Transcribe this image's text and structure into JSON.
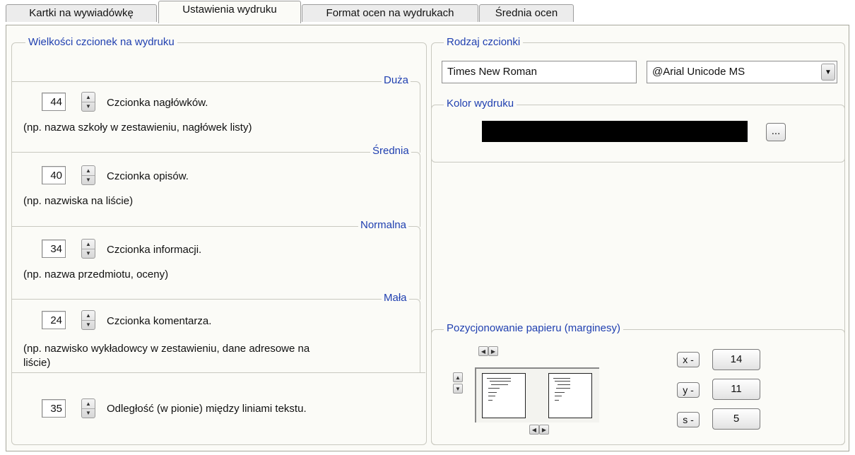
{
  "tabs": [
    {
      "label": "Kartki na wywiadówkę"
    },
    {
      "label": "Ustawienia wydruku"
    },
    {
      "label": "Format ocen na wydrukach"
    },
    {
      "label": "Średnia ocen"
    }
  ],
  "active_tab": "Ustawienia wydruku",
  "font_sizes": {
    "title": "Wielkości czcionek na wydruku",
    "rows": [
      {
        "size_label": "Duża",
        "value": "44",
        "name": "Czcionka nagłówków.",
        "example": "(np. nazwa szkoły w zestawieniu, nagłówek listy)"
      },
      {
        "size_label": "Średnia",
        "value": "40",
        "name": "Czcionka opisów.",
        "example": "(np. nazwiska na liście)"
      },
      {
        "size_label": "Normalna",
        "value": "34",
        "name": "Czcionka informacji.",
        "example": "(np. nazwa przedmiotu, oceny)"
      },
      {
        "size_label": "Mała",
        "value": "24",
        "name": "Czcionka komentarza.",
        "example_line1": "(np. nazwisko wykładowcy w zestawieniu, dane adresowe na",
        "example_line2": "liście)"
      }
    ],
    "line_spacing": {
      "value": "35",
      "label": "Odległość (w pionie) między liniami tekstu."
    }
  },
  "font_type": {
    "title": "Rodzaj czcionki",
    "font_name": "Times New Roman",
    "font_combo_value": "@Arial Unicode MS"
  },
  "print_color": {
    "title": "Kolor wydruku",
    "color": "#000000",
    "pick_button_label": "..."
  },
  "paper_position": {
    "title": "Pozycjonowanie papieru (marginesy)",
    "x_label": "x -",
    "x_value": "14",
    "y_label": "y -",
    "y_value": "11",
    "s_label": "s -",
    "s_value": "5"
  },
  "colors": {
    "group_title": "#1f3fb0",
    "panel_bg": "#fbfbf7"
  }
}
